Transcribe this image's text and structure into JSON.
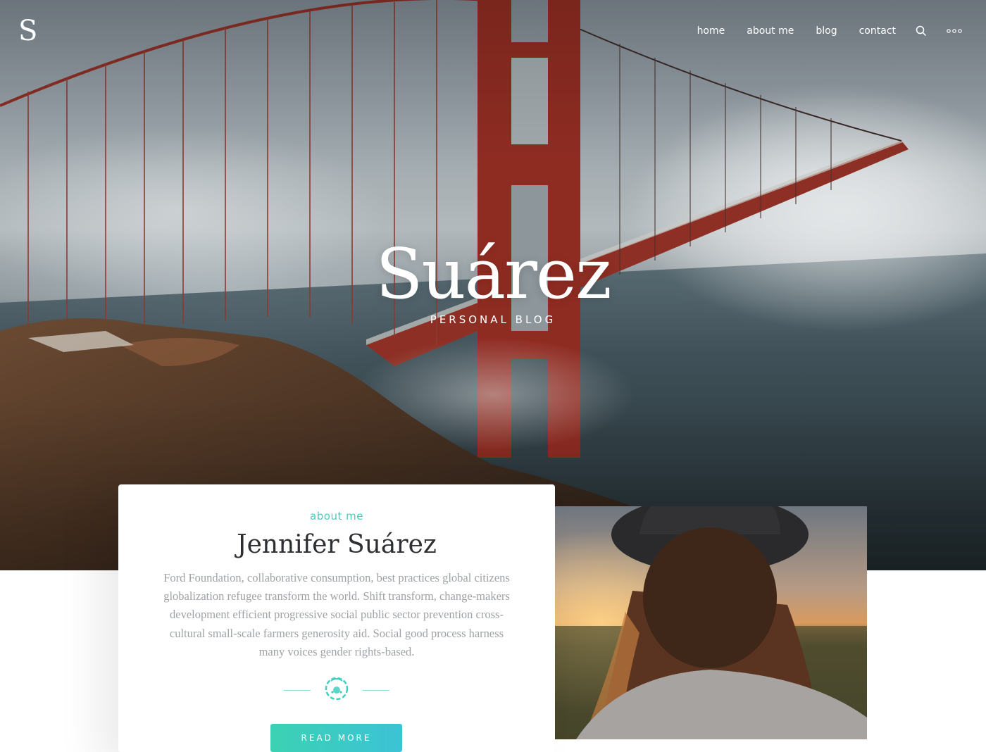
{
  "header": {
    "logo": "S",
    "nav": {
      "home": "home",
      "about": "about me",
      "blog": "blog",
      "contact": "contact"
    },
    "icons": [
      "search-icon",
      "more-dots-icon"
    ]
  },
  "hero": {
    "title": "Suárez",
    "subtitle": "PERSONAL BLOG",
    "background_image": "golden-gate-bridge-in-fog"
  },
  "about": {
    "eyebrow": "about me",
    "name": "Jennifer Suárez",
    "bio": "Ford Foundation, collaborative consumption, best practices global citizens globalization refugee transform the world. Shift transform, change-makers development efficient progressive social public sector prevention cross-cultural small-scale farmers generosity aid. Social good process harness many voices gender rights-based.",
    "button": "READ MORE",
    "photo": "woman-in-hat-at-sunset",
    "divider_icon": "wreath-emblem-icon"
  },
  "colors": {
    "accent": "#3ecfbd",
    "accent_gradient_end": "#3cc3d6",
    "title_text": "#2d2f33",
    "body_text": "#9ea2a7"
  }
}
